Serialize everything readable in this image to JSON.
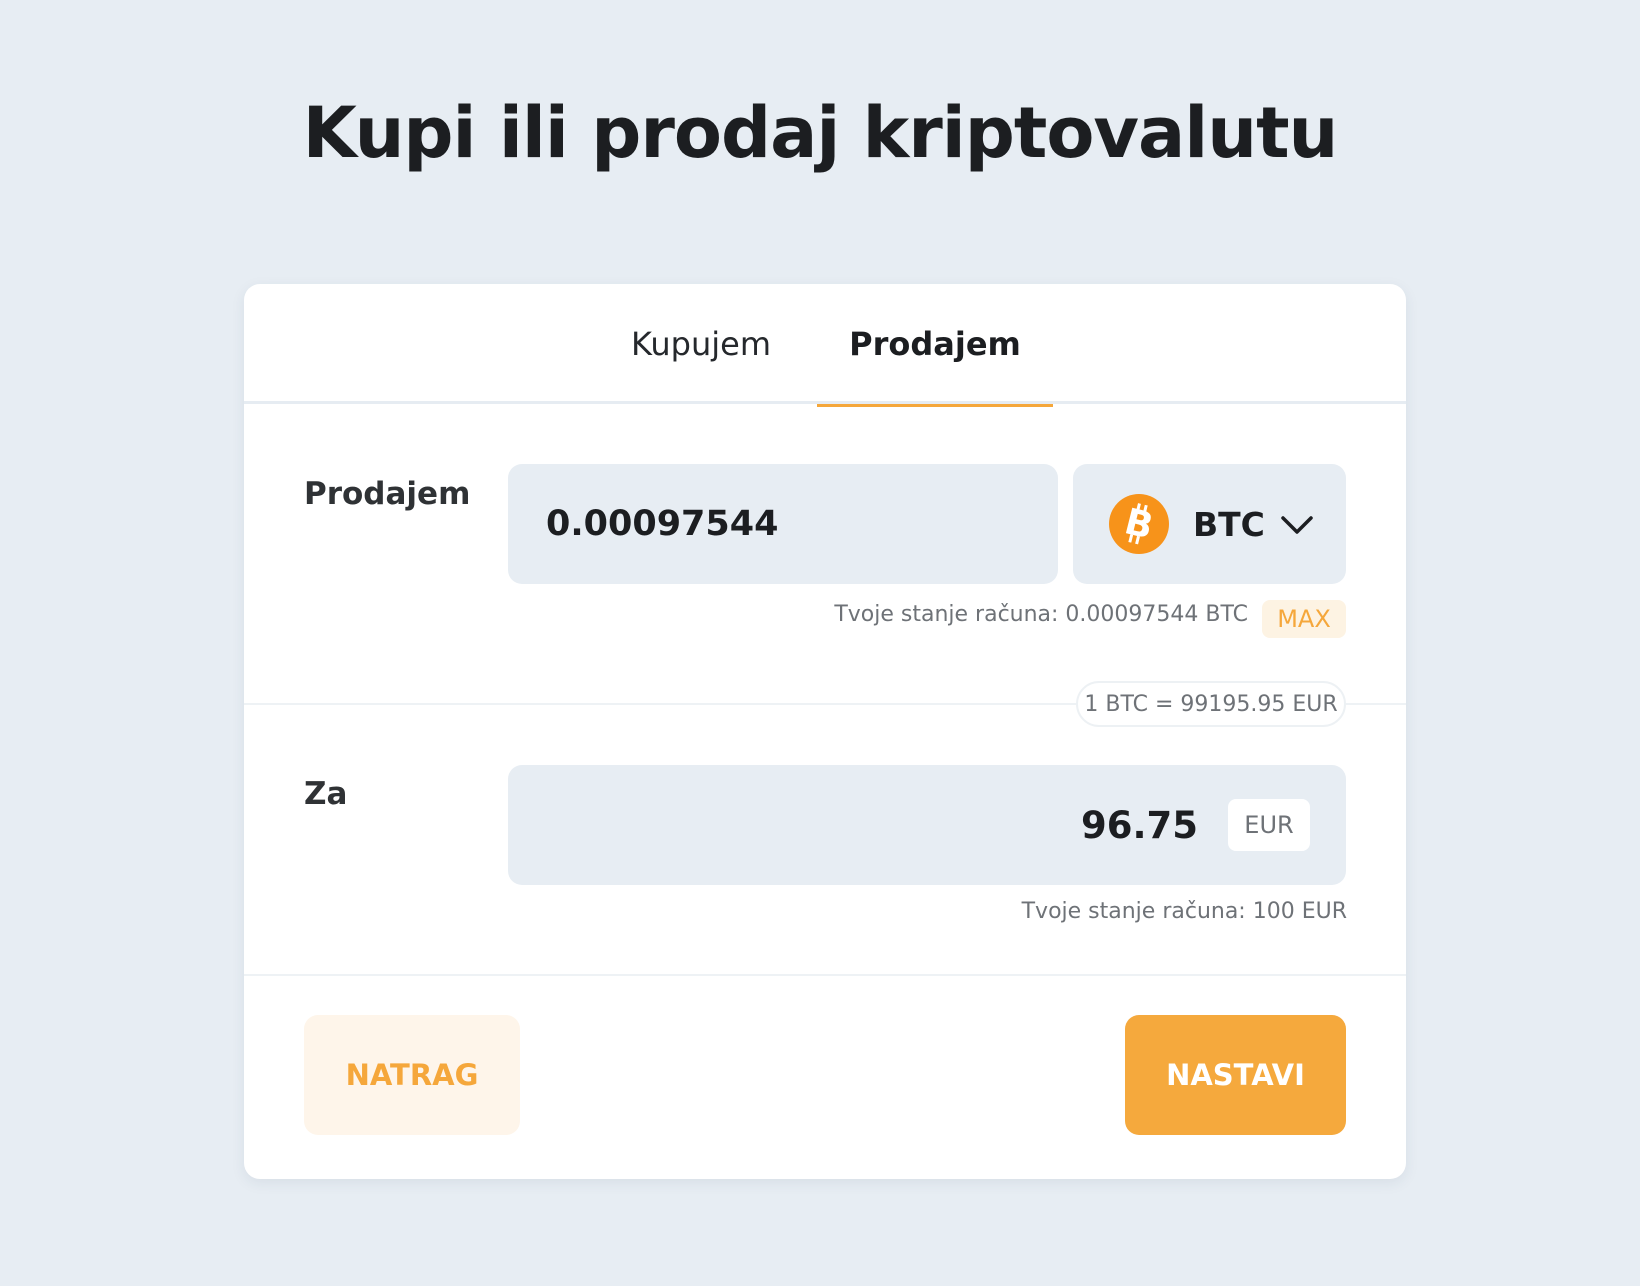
{
  "page": {
    "title": "Kupi ili prodaj kriptovalutu"
  },
  "tabs": [
    {
      "label": "Kupujem",
      "active": false
    },
    {
      "label": "Prodajem",
      "active": true
    }
  ],
  "sell_row": {
    "label": "Prodajem",
    "amount": "0.00097544",
    "currency": "BTC",
    "currency_icon": "bitcoin-icon",
    "balance_text": "Tvoje stanje računa: 0.00097544 BTC",
    "max_label": "MAX"
  },
  "rate": {
    "text": "1 BTC = 99195.95 EUR"
  },
  "receive_row": {
    "label": "Za",
    "amount": "96.75",
    "currency": "EUR",
    "balance_text": "Tvoje stanje računa: 100 EUR"
  },
  "actions": {
    "back_label": "NATRAG",
    "next_label": "NASTAVI"
  },
  "colors": {
    "accent": "#f5a73b",
    "background": "#e7edf3",
    "bitcoin": "#f7931a"
  }
}
